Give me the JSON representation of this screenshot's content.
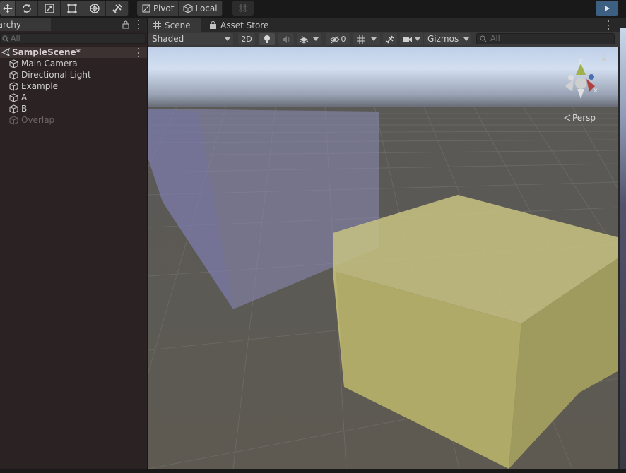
{
  "toolbar": {
    "tools": [
      "hand-tool",
      "move-tool",
      "rotate-tool",
      "scale-tool",
      "rect-tool",
      "transform-tool",
      "custom-tool"
    ],
    "pivot_label": "Pivot",
    "local_label": "Local",
    "play_icon": "play-icon"
  },
  "hierarchy": {
    "tab_label": "Hierarchy",
    "search_placeholder": "All",
    "scene_name": "SampleScene*",
    "items": [
      {
        "label": "Main Camera"
      },
      {
        "label": "Directional Light"
      },
      {
        "label": "Example"
      },
      {
        "label": "A"
      },
      {
        "label": "B"
      },
      {
        "label": "Overlap"
      }
    ]
  },
  "scene": {
    "tabs": [
      {
        "label": "Scene",
        "icon": "grid-icon"
      },
      {
        "label": "Asset Store",
        "icon": "shopping-bag-icon"
      }
    ],
    "shading_mode": "Shaded",
    "mode_2d_label": "2D",
    "hidden_count": "0",
    "gizmos_label": "Gizmos",
    "search_placeholder": "All",
    "persp_label": "Persp",
    "axis_labels": {
      "y": "y",
      "x": "x"
    }
  },
  "colors": {
    "accent": "#3d5f82",
    "box_a": "#8a8ab8",
    "box_b": "#c9c47a",
    "axis_y": "#a2b04a",
    "axis_x": "#b0403c",
    "axis_z": "#4a6fb0"
  }
}
